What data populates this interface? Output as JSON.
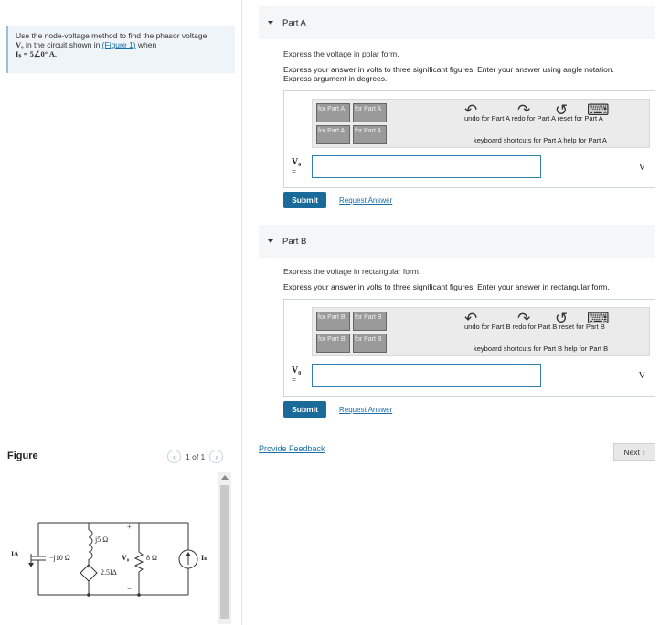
{
  "problem": {
    "line1": "Use the node-voltage method to find the phasor voltage",
    "line2_var": "V₀",
    "line2_text": " in the circuit shown in ",
    "figure_link": "(Figure 1)",
    "line2_end": " when",
    "line3": "Iₛ = 5∠0° A."
  },
  "figure": {
    "title": "Figure",
    "pager": "1 of 1",
    "labels": {
      "ia": "IΔ",
      "j5": "j5 Ω",
      "jm10": "−j10 Ω",
      "dep": "2.5IΔ",
      "vo": "V₀",
      "r8": "8 Ω",
      "is": "Iₛ",
      "plus": "+",
      "minus": "−"
    }
  },
  "partA": {
    "title": "Part A",
    "instr1": "Express the voltage in polar form.",
    "instr2": "Express your answer in volts to three significant figures. Enter your answer using angle notation.",
    "instr3": "Express argument in degrees.",
    "toolbar": {
      "b1a": "for Part A",
      "b1b": "for Part A",
      "b2a": "for Part A",
      "b2b": "for Part A",
      "b3a": "for Part A",
      "b3b": "for Part A",
      "b4a": "for Part A",
      "b4b": "for Part A",
      "links1": "undo for Part A redo for Part A reset for Part A",
      "links2": "keyboard shortcuts for Part A  help for Part A"
    },
    "var": "V₀",
    "eq": "=",
    "unit": "V",
    "submit": "Submit",
    "request": "Request Answer"
  },
  "partB": {
    "title": "Part B",
    "instr1": "Express the voltage in rectangular form.",
    "instr2": "Express your answer in volts to three significant figures. Enter your answer in rectangular form.",
    "toolbar": {
      "b1a": "for Part B",
      "b1b": "for Part B",
      "b2a": "for Part B",
      "b2b": "for Part B",
      "b3a": "for Part B",
      "b3b": "for Part B",
      "b4a": "for Part B",
      "b4b": "for Part B",
      "links1": "undo for Part B redo for Part B reset for Part B",
      "links2": "keyboard shortcuts for Part B  help for Part B"
    },
    "var": "V₀",
    "eq": "=",
    "unit": "V",
    "submit": "Submit",
    "request": "Request Answer"
  },
  "footer": {
    "feedback": "Provide Feedback",
    "next": "Next"
  }
}
